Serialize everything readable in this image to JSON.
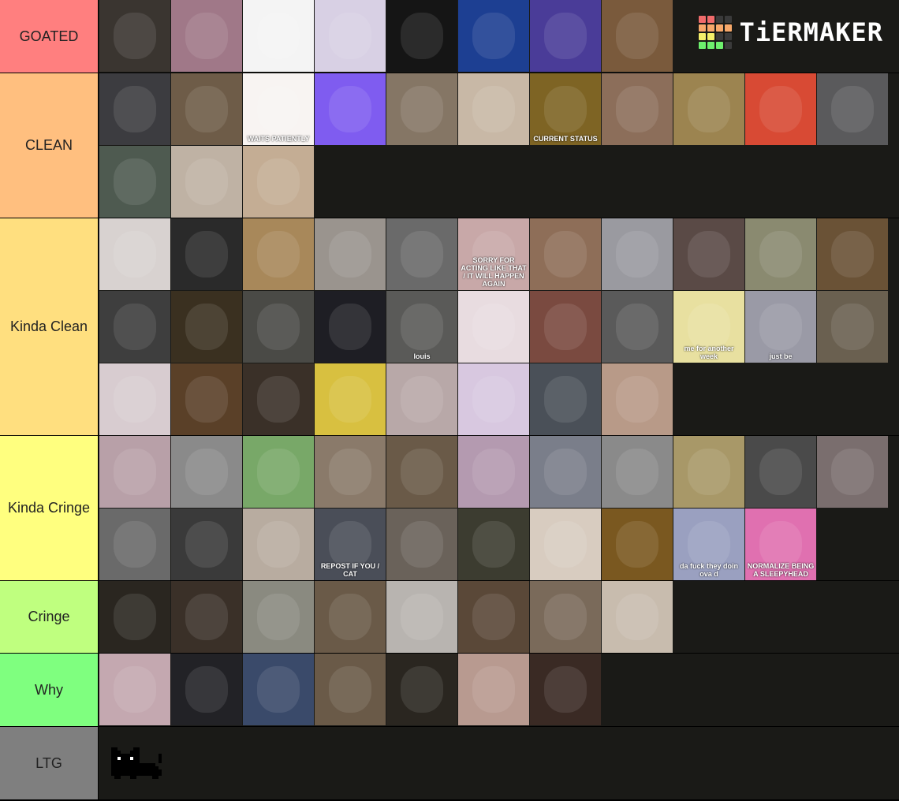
{
  "logo": {
    "text": "TiERMAKER",
    "grid": [
      "#f06b6b",
      "#f06b6b",
      "#3a3a3a",
      "#3a3a3a",
      "#f7a86a",
      "#f7a86a",
      "#f7a86a",
      "#f7a86a",
      "#f4f06a",
      "#f4f06a",
      "#3a3a3a",
      "#3a3a3a",
      "#6df06d",
      "#6df06d",
      "#6df06d",
      "#3a3a3a"
    ]
  },
  "tiers": [
    {
      "label": "GOATED",
      "color": "#ff7f7f",
      "items": [
        {
          "c": "#3a3530"
        },
        {
          "c": "#a07888"
        },
        {
          "c": "#f4f4f4"
        },
        {
          "c": "#d8d0e4"
        },
        {
          "c": "#151515"
        },
        {
          "c": "#1d3f92"
        },
        {
          "c": "#4a3c98"
        },
        {
          "c": "#7a5a3c"
        }
      ]
    },
    {
      "label": "CLEAN",
      "color": "#ffbf7f",
      "items": [
        {
          "c": "#3c3c40"
        },
        {
          "c": "#6e5c48"
        },
        {
          "c": "#f8f4f2",
          "t": "WAITS PATIENTLY"
        },
        {
          "c": "#7f5cf0"
        },
        {
          "c": "#857665"
        },
        {
          "c": "#c8b8a6"
        },
        {
          "c": "#7e6424",
          "t": "CURRENT STATUS"
        },
        {
          "c": "#8c6e5a"
        },
        {
          "c": "#9c8450"
        },
        {
          "c": "#d84a34"
        },
        {
          "c": "#5a5a5c"
        },
        {
          "c": "#4e5a50"
        },
        {
          "c": "#bfb2a4"
        },
        {
          "c": "#c4ad94"
        }
      ]
    },
    {
      "label": "Kinda Clean",
      "color": "#ffdf7f",
      "items": [
        {
          "c": "#d8d2d0"
        },
        {
          "c": "#2a2a2a"
        },
        {
          "c": "#a8885a"
        },
        {
          "c": "#9a948e"
        },
        {
          "c": "#6a6a6a"
        },
        {
          "c": "#c8a8a8",
          "t": "SORRY FOR ACTING LIKE THAT / IT WILL HAPPEN AGAIN"
        },
        {
          "c": "#8e6e58"
        },
        {
          "c": "#9a9aa0"
        },
        {
          "c": "#5a4a46"
        },
        {
          "c": "#8a8a70"
        },
        {
          "c": "#6a5236"
        },
        {
          "c": "#3e3e3e"
        },
        {
          "c": "#3a3020"
        },
        {
          "c": "#4a4a46"
        },
        {
          "c": "#1e1e24"
        },
        {
          "c": "#5a5a58",
          "t": "louis"
        },
        {
          "c": "#e8dce0"
        },
        {
          "c": "#7a4a40"
        },
        {
          "c": "#5a5a5a"
        },
        {
          "c": "#e8e0a0",
          "t": "me for another week"
        },
        {
          "c": "#9a9aa6",
          "t": "just be"
        },
        {
          "c": "#6a6050"
        },
        {
          "c": "#d8ccd0"
        },
        {
          "c": "#5a4028"
        },
        {
          "c": "#3a3028"
        },
        {
          "c": "#d8c040"
        },
        {
          "c": "#b8a8a8"
        },
        {
          "c": "#d8c8e0"
        },
        {
          "c": "#4a5058"
        },
        {
          "c": "#b89a88"
        }
      ]
    },
    {
      "label": "Kinda Cringe",
      "color": "#ffff7f",
      "items": [
        {
          "c": "#b8a0a8"
        },
        {
          "c": "#8a8a8a"
        },
        {
          "c": "#78a868"
        },
        {
          "c": "#8a7a6a"
        },
        {
          "c": "#6a5a48"
        },
        {
          "c": "#b49ab0"
        },
        {
          "c": "#7a7e8a"
        },
        {
          "c": "#8a8a8a"
        },
        {
          "c": "#a89868"
        },
        {
          "c": "#4a4a4a"
        },
        {
          "c": "#7a6e6e"
        },
        {
          "c": "#6a6a6a"
        },
        {
          "c": "#3a3a3a"
        },
        {
          "c": "#b8aca0"
        },
        {
          "c": "#4a4e58",
          "t": "REPOST IF YOU / CAT"
        },
        {
          "c": "#6a625a"
        },
        {
          "c": "#3c3c30"
        },
        {
          "c": "#d8ccc0"
        },
        {
          "c": "#7a5820"
        },
        {
          "c": "#9aa0c0",
          "t": "da fuck they doin ova d"
        },
        {
          "c": "#e070b0",
          "t": "NORMALIZE BEING A SLEEPYHEAD"
        }
      ]
    },
    {
      "label": "Cringe",
      "color": "#bfff7f",
      "items": [
        {
          "c": "#2a2620"
        },
        {
          "c": "#3a3028"
        },
        {
          "c": "#8a8a80"
        },
        {
          "c": "#6a5a48"
        },
        {
          "c": "#b8b4b0"
        },
        {
          "c": "#5a4838"
        },
        {
          "c": "#7a6a5a"
        },
        {
          "c": "#c8bcae"
        }
      ]
    },
    {
      "label": "Why",
      "color": "#7fff7f",
      "items": [
        {
          "c": "#c4a8b0"
        },
        {
          "c": "#222226"
        },
        {
          "c": "#3a4a6a"
        },
        {
          "c": "#6a5a48"
        },
        {
          "c": "#2a2620"
        },
        {
          "c": "#b89a90"
        },
        {
          "c": "#3a2a24"
        }
      ]
    },
    {
      "label": "LTG",
      "color": "#7f7f7f",
      "items": []
    }
  ]
}
